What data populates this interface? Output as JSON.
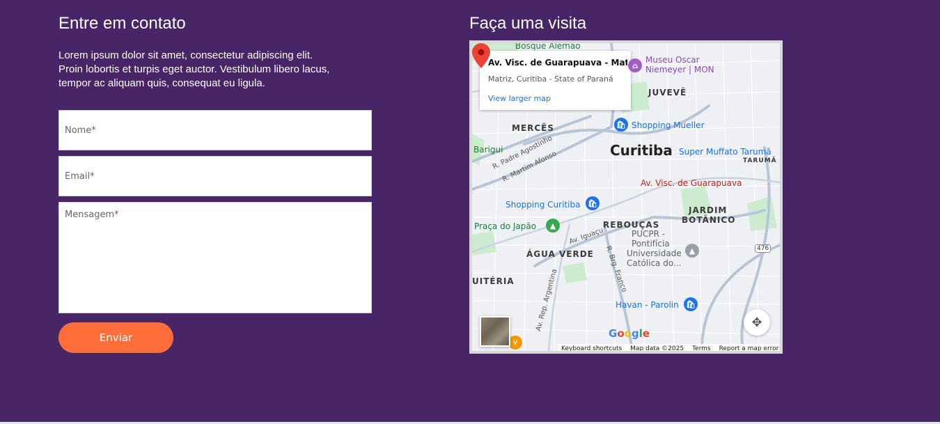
{
  "contact": {
    "title": "Entre em contato",
    "intro_line1": "Lorem ipsum dolor sit amet, consectetur adipiscing elit.",
    "intro_line2": "Proin lobortis et turpis eget auctor. Vestibulum libero lacus,",
    "intro_line3": "tempor ac aliquam quis, consequat eu ligula.",
    "name_placeholder": "Nome*",
    "email_placeholder": "Email*",
    "message_placeholder": "Mensagem*",
    "submit_label": "Enviar"
  },
  "visit": {
    "title": "Faça uma visita"
  },
  "map": {
    "info_title": "Av. Visc. de Guarapuava - Mat...",
    "info_subtitle": "Matriz, Curitiba - State of Paraná",
    "info_link": "View larger map",
    "labels": {
      "bosque": "Bosque Alemão",
      "museu1": "Museu Oscar",
      "museu2": "Niemeyer | MON",
      "juveve": "JUVEVÊ",
      "merces": "MERCÊS",
      "shopping_mueller": "Shopping Mueller",
      "barigui": "Barigui",
      "curitiba": "Curitiba",
      "supermuffato": "Super Muffato Tarumã",
      "taruma": "TARUMÃ",
      "padre": "R. Padre Agostinho",
      "martim": "R. Martim Afonso",
      "marker_label": "Av. Visc. de Guarapuava",
      "shopping_curitiba": "Shopping Curitiba",
      "jardim": "JARDIM",
      "botanico": "BOTÂNICO",
      "praca": "Praça do Japão",
      "reboucas": "REBOUÇAS",
      "iguacu": "Av. Iguaçu",
      "pucpr1": "PUCPR -",
      "pucpr2": "Pontifícia",
      "pucpr3": "Universidade",
      "pucpr4": "Católica do...",
      "agua_verde": "ÁGUA VERDE",
      "brg": "R. Brg. Franco",
      "uiteria": "UITÉRIA",
      "argentina": "Av. Rep. Argentina",
      "havan": "Havan - Parolin",
      "route": "476"
    },
    "google": [
      "G",
      "o",
      "o",
      "g",
      "l",
      "e"
    ],
    "footer": {
      "shortcuts": "Keyboard shortcuts",
      "data": "Map data ©2025",
      "terms": "Terms",
      "report": "Report a map error"
    },
    "colors": {
      "pin_red": "#ea4335",
      "poi_blue": "#1a73e8",
      "park_green": "#188038",
      "museum_purple": "#8a4ab5"
    }
  },
  "colors": {
    "background": "#472566",
    "button": "#ff6e3a"
  }
}
